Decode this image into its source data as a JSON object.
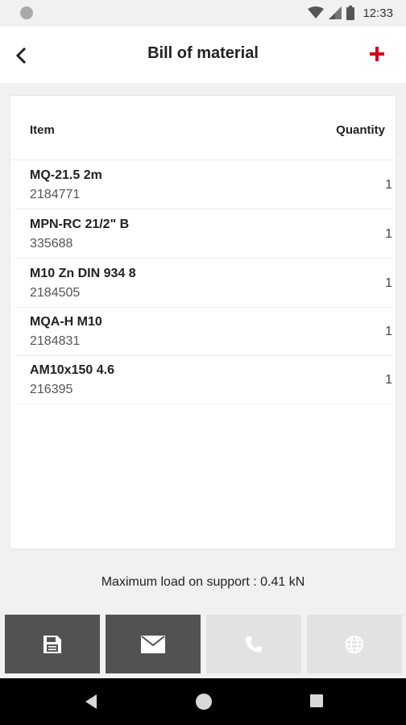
{
  "status_bar": {
    "time": "12:33",
    "icons": [
      "notification-dot-icon",
      "wifi-icon",
      "signal-icon",
      "battery-icon"
    ]
  },
  "header": {
    "title": "Bill of material",
    "back_icon": "chevron-left-icon",
    "add_icon": "plus-icon",
    "accent_color": "#d0021b"
  },
  "table": {
    "columns": [
      "Item",
      "Quantity"
    ],
    "rows": [
      {
        "name": "MQ-21.5 2m",
        "code": "2184771",
        "quantity": "1"
      },
      {
        "name": "MPN-RC 21/2\" B",
        "code": "335688",
        "quantity": "1"
      },
      {
        "name": "M10 Zn DIN 934 8",
        "code": "2184505",
        "quantity": "1"
      },
      {
        "name": "MQA-H M10",
        "code": "2184831",
        "quantity": "1"
      },
      {
        "name": "AM10x150 4.6",
        "code": "216395",
        "quantity": "1"
      }
    ]
  },
  "footer": {
    "max_load_text": "Maximum load on support : 0.41 kN"
  },
  "actions": [
    {
      "icon": "save-icon",
      "enabled": true
    },
    {
      "icon": "mail-icon",
      "enabled": true
    },
    {
      "icon": "phone-icon",
      "enabled": false
    },
    {
      "icon": "globe-icon",
      "enabled": false
    }
  ],
  "colors": {
    "action_dark": "#525252",
    "action_light": "#e2e2e2",
    "background": "#f1f1f1"
  }
}
